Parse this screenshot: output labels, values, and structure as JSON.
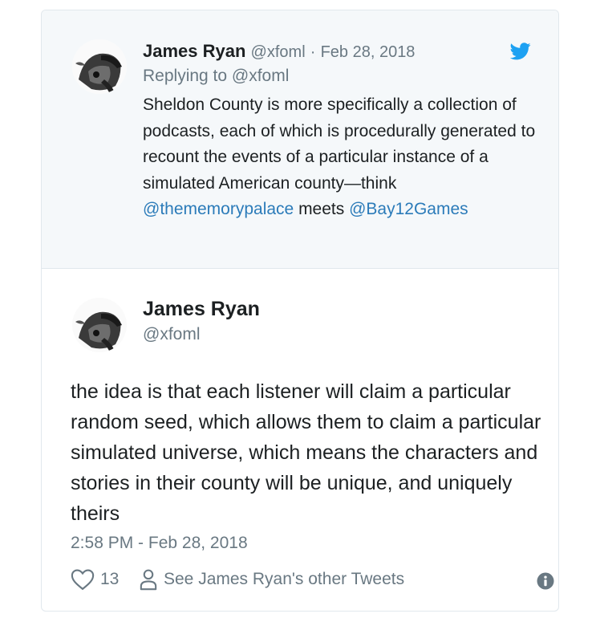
{
  "parent_tweet": {
    "author_name": "James Ryan",
    "author_handle": "@xfoml",
    "separator": "·",
    "date": "Feb 28, 2018",
    "replying_to_prefix": "Replying to",
    "replying_to_handle": "@xfoml",
    "text_part1": "Sheldon County is more specifically a collection of podcasts, each of which is procedurally generated to recount the events of a particular instance of a simulated American county—think ",
    "mention1": "@thememorypalace",
    "text_part2": " meets ",
    "mention2": "@Bay12Games",
    "brand_icon": "twitter-bird-icon"
  },
  "main_tweet": {
    "author_name": "James Ryan",
    "author_handle": "@xfoml",
    "text": "the idea is that each listener will claim a particular random seed, which allows them to claim a particular simulated universe, which means the characters and stories in their county will be unique, and uniquely theirs",
    "timestamp": "2:58 PM - Feb 28, 2018",
    "like_count": "13",
    "other_tweets_label": "See James Ryan's other Tweets"
  },
  "colors": {
    "link": "#2b7bb9",
    "muted": "#697882",
    "text": "#1c2022",
    "parent_bg": "#f5f8fa",
    "border": "#e1e8ed",
    "bird": "#1da1f2"
  }
}
